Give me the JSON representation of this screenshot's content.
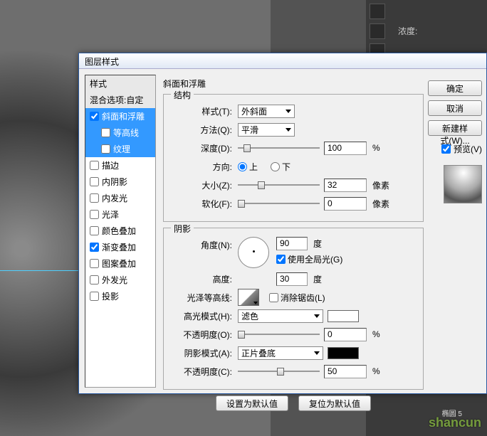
{
  "bg": {
    "density_label": "浓度:",
    "shape_label": "椭圆 5"
  },
  "dialog": {
    "title": "图层样式",
    "tab_title": "斜面和浮雕",
    "sidebar": {
      "styles": "样式",
      "blend": "混合选项:自定",
      "bevel": "斜面和浮雕",
      "contour": "等高线",
      "texture": "纹理",
      "stroke": "描边",
      "inner_shadow": "内阴影",
      "inner_glow": "内发光",
      "satin": "光泽",
      "color_overlay": "颜色叠加",
      "grad_overlay": "渐变叠加",
      "pattern_overlay": "图案叠加",
      "outer_glow": "外发光",
      "drop_shadow": "投影"
    },
    "structure": {
      "legend": "结构",
      "style_label": "样式(T):",
      "style_value": "外斜面",
      "method_label": "方法(Q):",
      "method_value": "平滑",
      "depth_label": "深度(D):",
      "depth_value": "100",
      "depth_unit": "%",
      "direction_label": "方向:",
      "up": "上",
      "down": "下",
      "size_label": "大小(Z):",
      "size_value": "32",
      "size_unit": "像素",
      "soften_label": "软化(F):",
      "soften_value": "0",
      "soften_unit": "像素"
    },
    "shading": {
      "legend": "阴影",
      "angle_label": "角度(N):",
      "angle_value": "90",
      "angle_unit": "度",
      "global_light": "使用全局光(G)",
      "altitude_label": "高度:",
      "altitude_value": "30",
      "altitude_unit": "度",
      "gloss_contour_label": "光泽等高线:",
      "anti_alias": "消除锯齿(L)",
      "highlight_mode_label": "高光模式(H):",
      "highlight_mode_value": "滤色",
      "highlight_opacity_label": "不透明度(O):",
      "highlight_opacity_value": "0",
      "highlight_opacity_unit": "%",
      "shadow_mode_label": "阴影模式(A):",
      "shadow_mode_value": "正片叠底",
      "shadow_opacity_label": "不透明度(C):",
      "shadow_opacity_value": "50",
      "shadow_opacity_unit": "%"
    },
    "buttons": {
      "make_default": "设置为默认值",
      "reset_default": "复位为默认值",
      "ok": "确定",
      "cancel": "取消",
      "new_style": "新建样式(W)...",
      "preview": "预览(V)"
    }
  },
  "watermark": "shancun"
}
